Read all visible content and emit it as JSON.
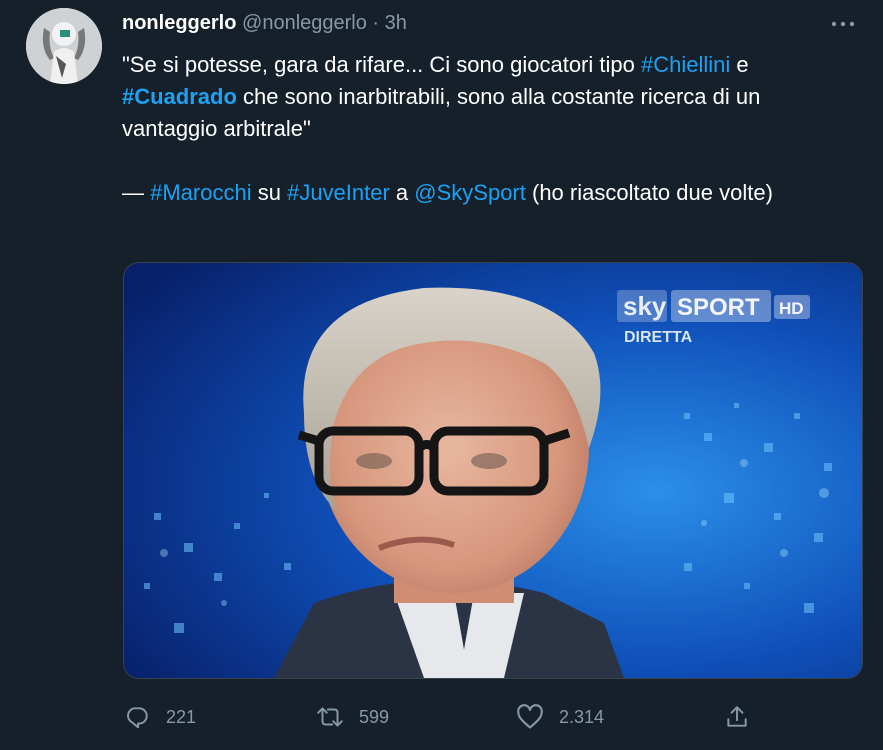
{
  "tweet": {
    "display_name": "nonleggerlo",
    "handle": "@nonleggerlo",
    "separator": "·",
    "time": "3h",
    "text": {
      "line1_pre": "\"Se si potesse, gara da rifare... Ci sono giocatori tipo ",
      "tag_chiellini": "#Chiellini",
      "line1_post": " e",
      "tag_cuadrado": "#Cuadrado",
      "line2_post": " che sono inarbitrabili, sono alla costante ricerca di un vantaggio arbitrale\"",
      "attrib_dash": "— ",
      "tag_marocchi": "#Marocchi",
      "word_su": " su ",
      "tag_juveinter": "#JuveInter",
      "word_a": " a ",
      "mention_skysport": "@SkySport",
      "attrib_post": " (ho riascoltato due volte)"
    },
    "media": {
      "broadcaster_logo_sky": "sky",
      "broadcaster_logo_sport": "SPORT",
      "broadcaster_logo_hd": "HD",
      "broadcaster_status": "DIRETTA"
    },
    "stats": {
      "replies": "221",
      "retweets": "599",
      "likes": "2.314"
    },
    "icons": {
      "reply": "reply-icon",
      "retweet": "retweet-icon",
      "like": "heart-icon",
      "share": "share-icon",
      "more": "more-icon"
    }
  },
  "colors": {
    "background": "#15202b",
    "link": "#1da1f2",
    "muted": "#8899a6"
  }
}
